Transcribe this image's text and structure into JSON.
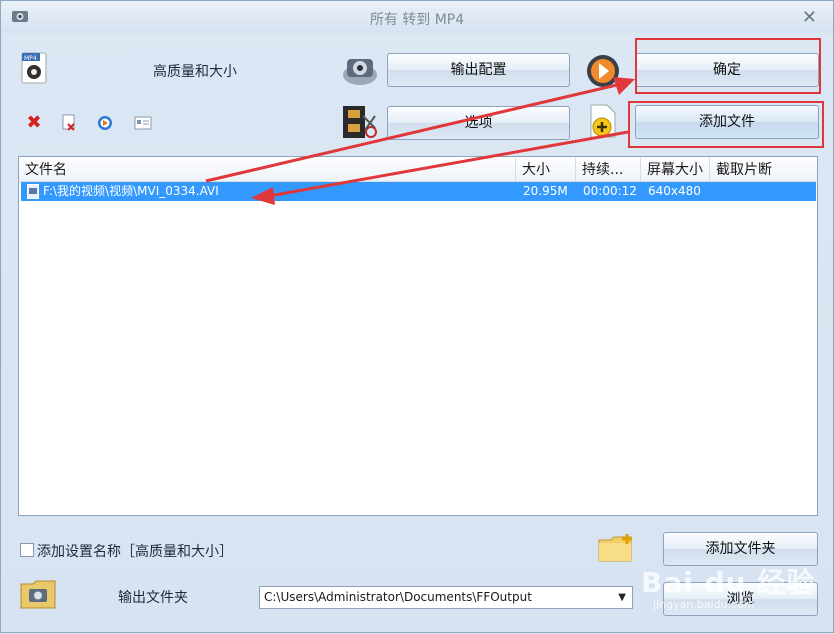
{
  "window": {
    "title": "所有 转到 MP4",
    "close_glyph": "✕"
  },
  "profile": {
    "name": "高质量和大小",
    "icon": "mp4-profile-icon"
  },
  "buttons": {
    "output_config": "输出配置",
    "ok": "确定",
    "options": "选项",
    "add_file": "添加文件",
    "add_folder": "添加文件夹",
    "browse": "浏览"
  },
  "toolbar": [
    "delete-icon",
    "remove-icon",
    "play-icon",
    "info-icon"
  ],
  "table": {
    "columns": [
      "文件名",
      "大小",
      "持续...",
      "屏幕大小",
      "截取片断"
    ],
    "rows": [
      {
        "name": "F:\\我的视频\\视频\\MVI_0334.AVI",
        "size": "20.95M",
        "duration": "00:00:12",
        "resolution": "640x480",
        "clip": ""
      }
    ]
  },
  "footer": {
    "append_setting_label": "添加设置名称［高质量和大小］",
    "output_folder_label": "输出文件夹",
    "output_path": "C:\\Users\\Administrator\\Documents\\FFOutput"
  },
  "watermark": {
    "main": "Bai du 经验",
    "sub": "jingyan.baidu.com"
  },
  "colors": {
    "highlight": "#3399ff",
    "annotation": "#e0383a"
  }
}
